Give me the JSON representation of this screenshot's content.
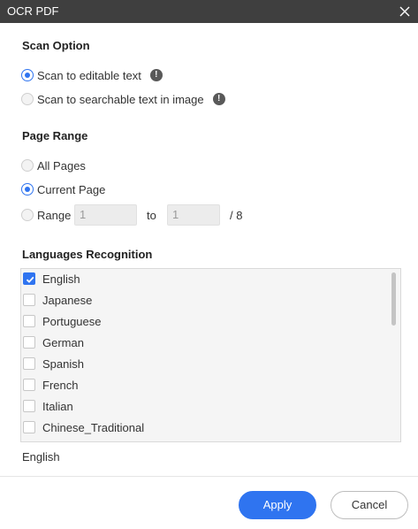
{
  "window": {
    "title": "OCR PDF"
  },
  "scan_option": {
    "heading": "Scan Option",
    "options": [
      {
        "label": "Scan to editable text",
        "selected": true,
        "info_icon": "info-icon"
      },
      {
        "label": "Scan to searchable text in image",
        "selected": false,
        "info_icon": "info-icon"
      }
    ]
  },
  "page_range": {
    "heading": "Page Range",
    "all_pages": "All Pages",
    "current_page": "Current Page",
    "range": "Range",
    "selected": "Current Page",
    "from_value": "1",
    "to_label": "to",
    "to_value": "1",
    "total": "/ 8"
  },
  "languages": {
    "heading": "Languages Recognition",
    "items": [
      {
        "label": "English",
        "checked": true
      },
      {
        "label": "Japanese",
        "checked": false
      },
      {
        "label": "Portuguese",
        "checked": false
      },
      {
        "label": "German",
        "checked": false
      },
      {
        "label": "Spanish",
        "checked": false
      },
      {
        "label": "French",
        "checked": false
      },
      {
        "label": "Italian",
        "checked": false
      },
      {
        "label": "Chinese_Traditional",
        "checked": false
      }
    ],
    "selected_summary": "English"
  },
  "buttons": {
    "apply": "Apply",
    "cancel": "Cancel"
  },
  "colors": {
    "accent": "#2f74f0",
    "titlebar": "#3f3f3f"
  }
}
